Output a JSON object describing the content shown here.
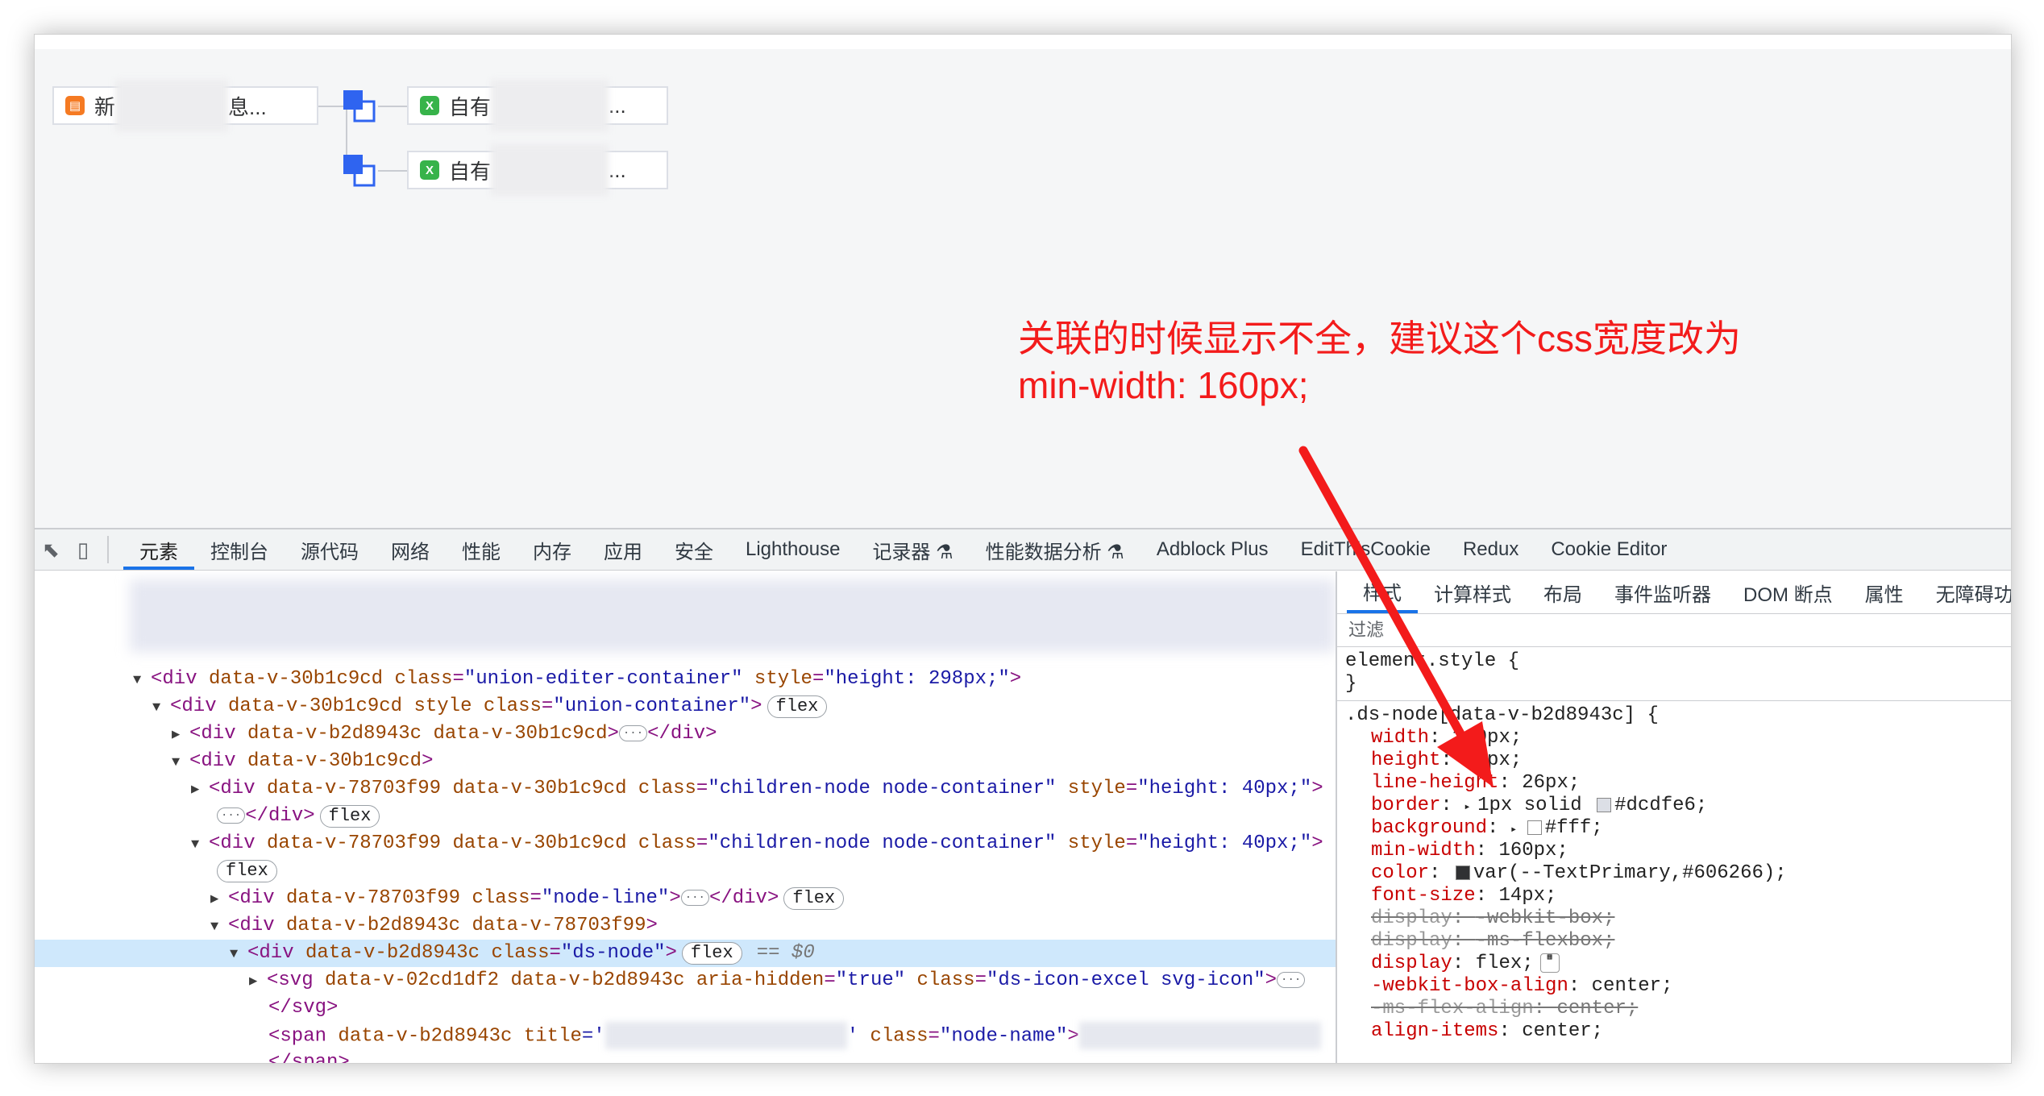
{
  "canvas": {
    "source_node": {
      "prefix": "新",
      "suffix": "息..."
    },
    "target_nodes": [
      {
        "prefix": "自有",
        "suffix": "..."
      },
      {
        "prefix": "自有",
        "suffix": "..."
      }
    ]
  },
  "annotation": {
    "line1": "关联的时候显示不全，建议这个css宽度改为",
    "line2": "min-width: 160px;"
  },
  "devtools": {
    "tabs": [
      "元素",
      "控制台",
      "源代码",
      "网络",
      "性能",
      "内存",
      "应用",
      "安全",
      "Lighthouse",
      "记录器 ⚗",
      "性能数据分析 ⚗",
      "Adblock Plus",
      "EditThisCookie",
      "Redux",
      "Cookie Editor"
    ],
    "active_tab": "元素",
    "styles_tabs": [
      "样式",
      "计算样式",
      "布局",
      "事件监听器",
      "DOM 断点",
      "属性",
      "无障碍功能"
    ],
    "filter_placeholder": "过滤",
    "dom": {
      "l1": {
        "tag_open": "<div ",
        "attrs": "data-v-30b1c9cd ",
        "a_class": "class",
        "v_class": "\"union-editer-container\"",
        "a_style": " style",
        "v_style": "\"height: 298px;\"",
        "close": ">"
      },
      "l2": {
        "tag_open": "<div ",
        "attrs": "data-v-30b1c9cd style ",
        "a_class": "class",
        "v_class": "\"union-container\"",
        "close": ">",
        "badge": "flex"
      },
      "l3": {
        "text1": "<div ",
        "attrs": "data-v-b2d8943c data-v-30b1c9cd",
        "close": ">",
        "end": "</div>"
      },
      "l4": {
        "text1": "<div ",
        "attrs": "data-v-30b1c9cd",
        "close": ">"
      },
      "l5": {
        "text1": "<div ",
        "attrs": "data-v-78703f99 data-v-30b1c9cd ",
        "a_class": "class",
        "v_class": "\"children-node node-container\"",
        "a_style": " style",
        "v_style": "\"height: 40px;\"",
        "close": ">"
      },
      "l6": {
        "end": "</div>",
        "badge": "flex"
      },
      "l7": {
        "text1": "<div ",
        "attrs": "data-v-78703f99 data-v-30b1c9cd ",
        "a_class": "class",
        "v_class": "\"children-node node-container\"",
        "a_style": " style",
        "v_style": "\"height: 40px;\"",
        "close": ">"
      },
      "l8": {
        "badge": "flex"
      },
      "l9": {
        "text1": "<div ",
        "attrs": "data-v-78703f99 ",
        "a_class": "class",
        "v_class": "\"node-line\"",
        "close": ">",
        "end": "</div>",
        "badge": "flex"
      },
      "l10": {
        "text1": "<div ",
        "attrs": "data-v-b2d8943c data-v-78703f99",
        "close": ">"
      },
      "l11": {
        "text1": "<div ",
        "attrs": "data-v-b2d8943c ",
        "a_class": "class",
        "v_class": "\"ds-node\"",
        "close": ">",
        "badge": "flex",
        "dollar": "== $0"
      },
      "l12": {
        "text1": "<svg ",
        "attrs": "data-v-02cd1df2 data-v-b2d8943c ",
        "a_aria": "aria-hidden",
        "v_aria": "\"true\"",
        "a_class": " class",
        "v_class": "\"ds-icon-excel svg-icon\"",
        "close": ">"
      },
      "l13": {
        "end": "</svg>"
      },
      "l14": {
        "text1": "<span ",
        "attrs": "data-v-b2d8943c ",
        "a_title": "title",
        "v_title_start": "='",
        "v_title_end": "'",
        "a_class": " class",
        "v_class": "\"node-name\"",
        "close": ">"
      },
      "l15": {
        "end": "</span>"
      }
    },
    "styles": {
      "element_style": {
        "selector": "element.style {",
        "close": "}"
      },
      "ds_node_rule": {
        "selector": ".ds-node[data-v-b2d8943c] {",
        "props": [
          {
            "name": "width",
            "value": "160px;",
            "struck": false
          },
          {
            "name": "height",
            "value": "26px;",
            "struck": false
          },
          {
            "name": "line-height",
            "value": "26px;",
            "struck": false
          },
          {
            "name": "border",
            "value": "1px solid ",
            "color_value": "#dcdfe6;",
            "swatch": "#dcdfe6",
            "struck": false
          },
          {
            "name": "background",
            "value": "",
            "color_value": "#fff;",
            "swatch": "#ffffff",
            "struck": false
          },
          {
            "name": "min-width",
            "value": "160px;",
            "struck": false
          },
          {
            "name": "color",
            "value": "",
            "color_value": "var(--TextPrimary,#606266);",
            "swatch": "#303133",
            "struck": false
          },
          {
            "name": "font-size",
            "value": "14px;",
            "struck": false
          },
          {
            "name": "display",
            "value": "-webkit-box;",
            "struck": true
          },
          {
            "name": "display",
            "value": "-ms-flexbox;",
            "struck": true
          },
          {
            "name": "display",
            "value": "flex;",
            "struck": false
          },
          {
            "name": "-webkit-box-align",
            "value": "center;",
            "struck": false
          },
          {
            "name": "-ms-flex-align",
            "value": "center;",
            "struck": true
          },
          {
            "name": "align-items",
            "value": "center;",
            "struck": false
          }
        ]
      }
    }
  },
  "colors": {
    "annotation": "#f31b1b",
    "accent": "#1a73e8",
    "selection": "#cfe8fc"
  }
}
